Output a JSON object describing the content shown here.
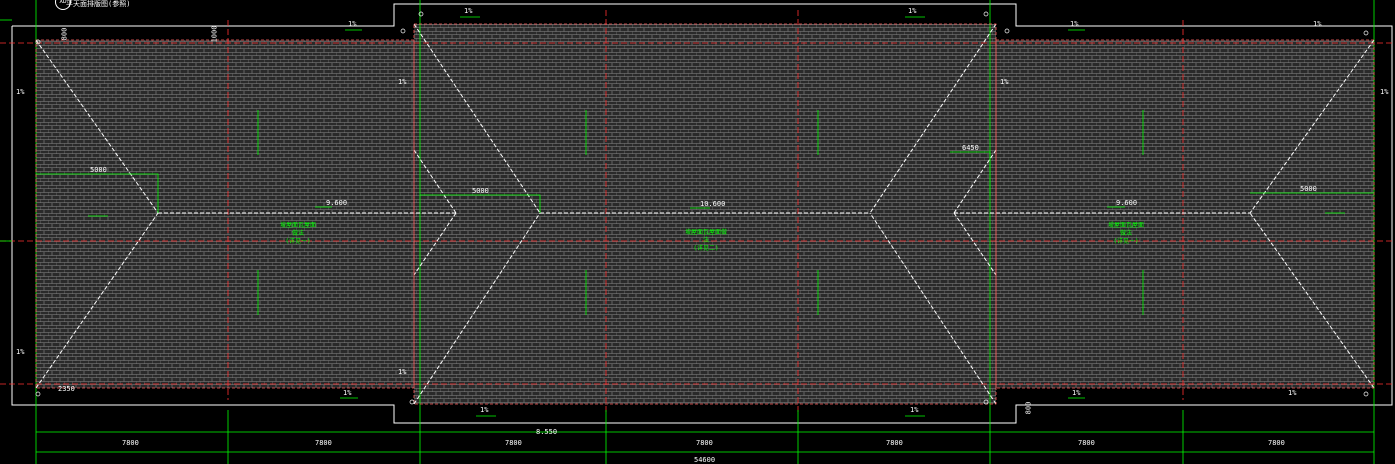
{
  "title": "平天面排版图(参照)",
  "detail_mark": "XD",
  "colors": {
    "background": "#000000",
    "outline": "#ffffff",
    "axis": "#ff3030",
    "dimension": "#00ff00",
    "tile_pattern": "#9a9a9a"
  },
  "slope_labels": [
    "1%",
    "1%",
    "1%",
    "1%",
    "1%",
    "1%",
    "1%",
    "1%",
    "1%",
    "1%"
  ],
  "side_slope": "1%",
  "ridge_lengths": [
    "5000",
    "5000",
    "5000"
  ],
  "offset_dim": "6450",
  "eave_dim": "2350",
  "elevations": {
    "left": "9.600",
    "middle": "10.600",
    "right": "9.600",
    "bottom": "8.550"
  },
  "zone_labels": {
    "left": [
      "坡屋面瓦屋面做法",
      "(详见一)"
    ],
    "middle": [
      "坡屋面瓦屋面做法",
      "(详见二)"
    ],
    "right": [
      "坡屋面瓦屋面做法",
      "(详见一)"
    ]
  },
  "axis_spacings": [
    "7800",
    "7800",
    "7800",
    "7800",
    "7800",
    "7800",
    "7800"
  ],
  "total_length": "54600",
  "small_dims": [
    "800",
    "1000",
    "800"
  ]
}
